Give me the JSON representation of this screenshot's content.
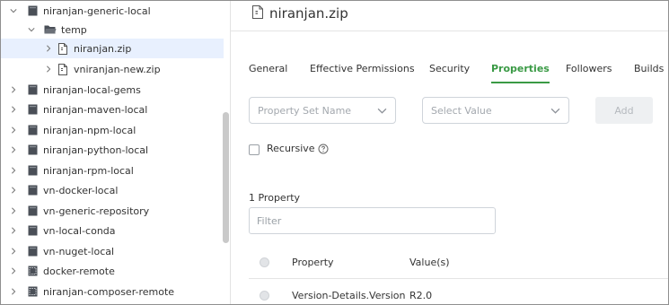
{
  "tree": {
    "items": [
      {
        "label": "niranjan-generic-local",
        "icon": "repository-icon",
        "expanded": true
      },
      {
        "label": "temp",
        "icon": "folder-open-icon",
        "expanded": true
      },
      {
        "label": "niranjan.zip",
        "icon": "file-icon",
        "selected": true
      },
      {
        "label": "vniranjan-new.zip",
        "icon": "file-icon"
      },
      {
        "label": "niranjan-local-gems",
        "icon": "repository-icon"
      },
      {
        "label": "niranjan-maven-local",
        "icon": "repository-icon"
      },
      {
        "label": "niranjan-npm-local",
        "icon": "repository-icon"
      },
      {
        "label": "niranjan-python-local",
        "icon": "repository-icon"
      },
      {
        "label": "niranjan-rpm-local",
        "icon": "repository-icon"
      },
      {
        "label": "vn-docker-local",
        "icon": "repository-icon"
      },
      {
        "label": "vn-generic-repository",
        "icon": "repository-icon"
      },
      {
        "label": "vn-local-conda",
        "icon": "repository-icon"
      },
      {
        "label": "vn-nuget-local",
        "icon": "repository-icon"
      },
      {
        "label": "docker-remote",
        "icon": "remote-repository-icon"
      },
      {
        "label": "niranjan-composer-remote",
        "icon": "remote-repository-icon"
      }
    ]
  },
  "detail": {
    "title": "niranjan.zip",
    "title_icon": "file-icon",
    "tabs": [
      {
        "label": "General"
      },
      {
        "label": "Effective Permissions"
      },
      {
        "label": "Security"
      },
      {
        "label": "Properties",
        "active": true
      },
      {
        "label": "Followers"
      },
      {
        "label": "Builds"
      }
    ],
    "property_set_placeholder": "Property Set Name",
    "value_placeholder": "Select Value",
    "add_label": "Add",
    "recursive_label": "Recursive",
    "property_count": "1 Property",
    "filter_placeholder": "Filter",
    "table": {
      "columns": [
        "Property",
        "Value(s)"
      ],
      "rows": [
        {
          "property": "Version-Details.Version",
          "value": "R2.0"
        }
      ]
    }
  },
  "colors": {
    "accent": "#3a9a45",
    "selected_row": "#e8f0fe",
    "icon_dark": "#4a4f57"
  }
}
